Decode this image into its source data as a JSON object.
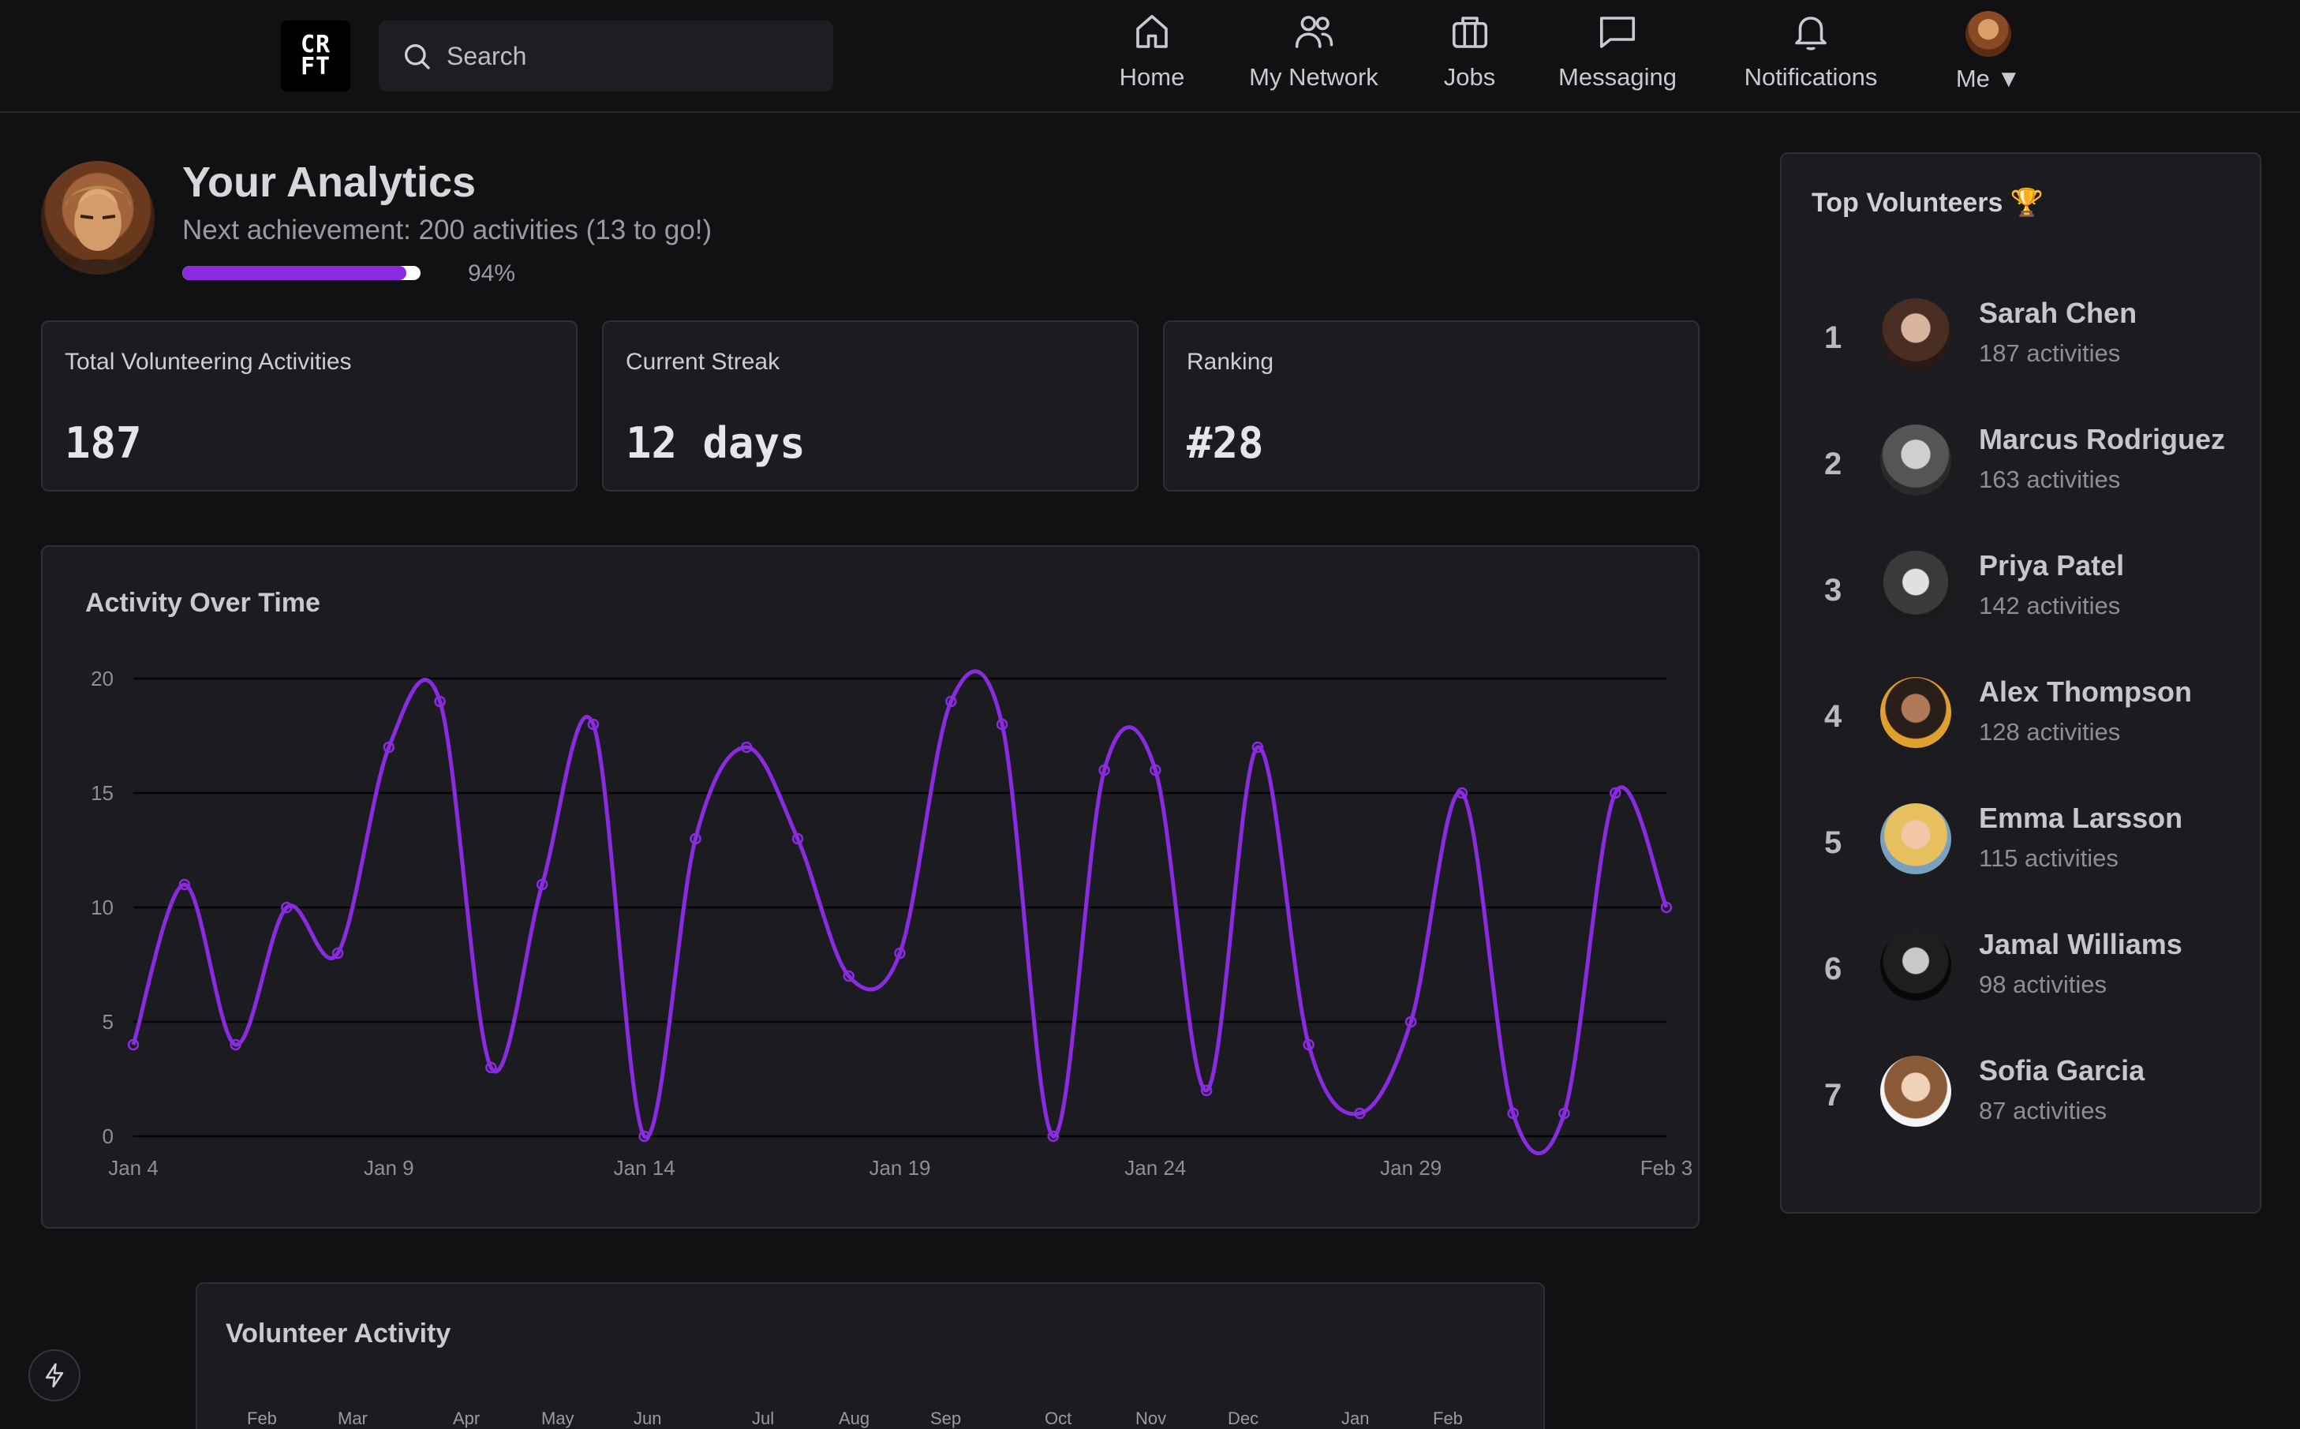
{
  "navbar": {
    "logo_line1": "CR",
    "logo_line2": "FT",
    "search_placeholder": "Search",
    "items": [
      {
        "label": "Home",
        "icon": "home-icon"
      },
      {
        "label": "My Network",
        "icon": "network-icon"
      },
      {
        "label": "Jobs",
        "icon": "briefcase-icon"
      },
      {
        "label": "Messaging",
        "icon": "message-icon"
      },
      {
        "label": "Notifications",
        "icon": "bell-icon"
      },
      {
        "label": "Me ▼",
        "icon": "avatar"
      }
    ]
  },
  "header": {
    "title": "Your Analytics",
    "achievement": "Next achievement: 200 activities (13 to go!)",
    "progress_percent": 94,
    "progress_label": "94%"
  },
  "stats": [
    {
      "label": "Total Volunteering Activities",
      "value": "187"
    },
    {
      "label": "Current Streak",
      "value": "12 days"
    },
    {
      "label": "Ranking",
      "value": "#28"
    }
  ],
  "chart": {
    "title": "Activity Over Time"
  },
  "chart_data": {
    "type": "line",
    "title": "Activity Over Time",
    "x": [
      "Jan 4",
      "Jan 5",
      "Jan 6",
      "Jan 7",
      "Jan 8",
      "Jan 9",
      "Jan 10",
      "Jan 11",
      "Jan 12",
      "Jan 13",
      "Jan 14",
      "Jan 15",
      "Jan 16",
      "Jan 17",
      "Jan 18",
      "Jan 19",
      "Jan 20",
      "Jan 21",
      "Jan 22",
      "Jan 23",
      "Jan 24",
      "Jan 25",
      "Jan 26",
      "Jan 27",
      "Jan 28",
      "Jan 29",
      "Jan 30",
      "Jan 31",
      "Feb 1",
      "Feb 2",
      "Feb 3"
    ],
    "x_ticks": [
      "Jan 4",
      "Jan 9",
      "Jan 14",
      "Jan 19",
      "Jan 24",
      "Jan 29",
      "Feb 3"
    ],
    "y_ticks": [
      0,
      5,
      10,
      15,
      20
    ],
    "series": [
      {
        "values": [
          4,
          11,
          4,
          10,
          8,
          17,
          19,
          3,
          11,
          18,
          0,
          13,
          17,
          13,
          7,
          8,
          19,
          18,
          0,
          16,
          16,
          2,
          17,
          4,
          1,
          5,
          15,
          1,
          1,
          15,
          10
        ],
        "color": "#8a2be2"
      }
    ],
    "ylim": [
      0,
      20
    ],
    "grid": true
  },
  "volunteer_activity": {
    "title": "Volunteer Activity",
    "months": [
      "Feb",
      "Mar",
      "Apr",
      "May",
      "Jun",
      "Jul",
      "Aug",
      "Sep",
      "Oct",
      "Nov",
      "Dec",
      "Jan",
      "Feb"
    ]
  },
  "top_volunteers": {
    "title": "Top Volunteers 🏆",
    "items": [
      {
        "rank": "1",
        "name": "Sarah Chen",
        "activities": "187 activities"
      },
      {
        "rank": "2",
        "name": "Marcus Rodriguez",
        "activities": "163 activities"
      },
      {
        "rank": "3",
        "name": "Priya Patel",
        "activities": "142 activities"
      },
      {
        "rank": "4",
        "name": "Alex Thompson",
        "activities": "128 activities"
      },
      {
        "rank": "5",
        "name": "Emma Larsson",
        "activities": "115 activities"
      },
      {
        "rank": "6",
        "name": "Jamal Williams",
        "activities": "98 activities"
      },
      {
        "rank": "7",
        "name": "Sofia Garcia",
        "activities": "87 activities"
      }
    ]
  },
  "colors": {
    "accent": "#8a2be2",
    "background": "#111114",
    "card": "#1c1c20"
  }
}
